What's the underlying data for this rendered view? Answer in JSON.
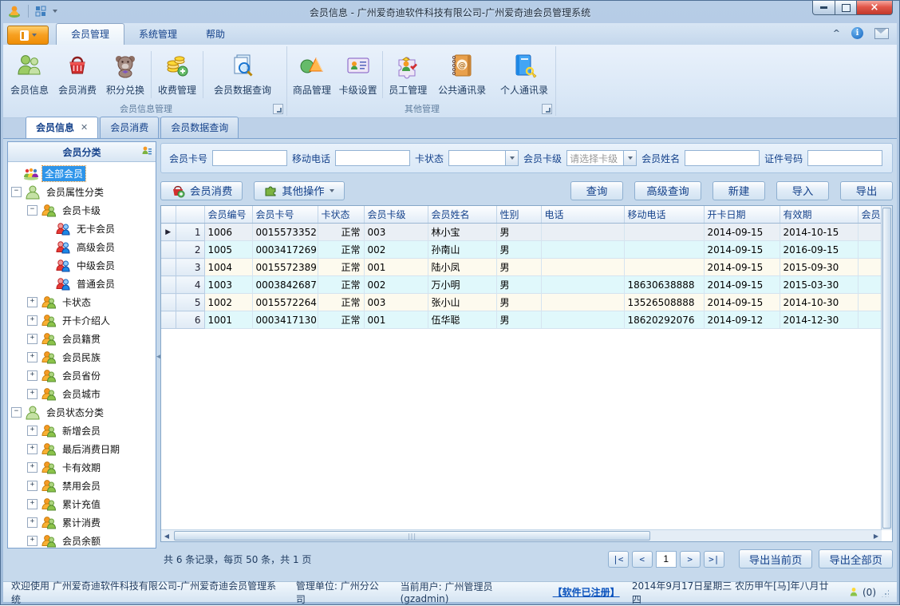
{
  "window": {
    "title": "会员信息 - 广州爱奇迪软件科技有限公司-广州爱奇迪会员管理系统",
    "controls": {
      "minimize": "最小化",
      "maximize": "最大化",
      "close": "×"
    }
  },
  "ribbon": {
    "tabs": [
      {
        "label": "会员管理",
        "active": true
      },
      {
        "label": "系统管理",
        "active": false
      },
      {
        "label": "帮助",
        "active": false
      }
    ],
    "groups": [
      {
        "label": "会员信息管理",
        "items": [
          {
            "label": "会员信息",
            "icon": "members-icon"
          },
          {
            "label": "会员消费",
            "icon": "basket-icon"
          },
          {
            "label": "积分兑换",
            "icon": "bear-icon"
          },
          {
            "label": "收费管理",
            "icon": "coins-icon",
            "sep_before": true
          },
          {
            "label": "会员数据查询",
            "icon": "doc-search-icon",
            "sep_before": true
          }
        ]
      },
      {
        "label": "其他管理",
        "items": [
          {
            "label": "商品管理",
            "icon": "goods-icon"
          },
          {
            "label": "卡级设置",
            "icon": "card-icon"
          },
          {
            "label": "员工管理",
            "icon": "staff-icon",
            "sep_before": true
          },
          {
            "label": "公共通讯录",
            "icon": "address-book-icon"
          },
          {
            "label": "个人通讯录",
            "icon": "personal-book-icon"
          }
        ]
      }
    ]
  },
  "doc_tabs": [
    {
      "label": "会员信息",
      "active": true,
      "closable": true
    },
    {
      "label": "会员消费",
      "active": false,
      "closable": false
    },
    {
      "label": "会员数据查询",
      "active": false,
      "closable": false
    }
  ],
  "sidebar": {
    "title": "会员分类",
    "tree": [
      {
        "label": "全部会员",
        "level": 1,
        "icon": "members-cluster-icon",
        "selected": true,
        "expand": ""
      },
      {
        "label": "会员属性分类",
        "level": 1,
        "icon": "member-group-icon",
        "expand": "minus"
      },
      {
        "label": "会员卡级",
        "level": 2,
        "icon": "member-pair-icon",
        "expand": "minus"
      },
      {
        "label": "无卡会员",
        "level": 3,
        "icon": "member-duo-icon",
        "expand": ""
      },
      {
        "label": "高级会员",
        "level": 3,
        "icon": "member-duo-icon",
        "expand": ""
      },
      {
        "label": "中级会员",
        "level": 3,
        "icon": "member-duo-icon",
        "expand": ""
      },
      {
        "label": "普通会员",
        "level": 3,
        "icon": "member-duo-icon",
        "expand": ""
      },
      {
        "label": "卡状态",
        "level": 2,
        "icon": "member-pair-icon",
        "expand": "plus"
      },
      {
        "label": "开卡介绍人",
        "level": 2,
        "icon": "member-pair-icon",
        "expand": "plus"
      },
      {
        "label": "会员籍贯",
        "level": 2,
        "icon": "member-pair-icon",
        "expand": "plus"
      },
      {
        "label": "会员民族",
        "level": 2,
        "icon": "member-pair-icon",
        "expand": "plus"
      },
      {
        "label": "会员省份",
        "level": 2,
        "icon": "member-pair-icon",
        "expand": "plus"
      },
      {
        "label": "会员城市",
        "level": 2,
        "icon": "member-pair-icon",
        "expand": "plus"
      },
      {
        "label": "会员状态分类",
        "level": 1,
        "icon": "member-group-icon",
        "expand": "minus"
      },
      {
        "label": "新增会员",
        "level": 2,
        "icon": "member-pair-icon",
        "expand": "plus"
      },
      {
        "label": "最后消费日期",
        "level": 2,
        "icon": "member-pair-icon",
        "expand": "plus"
      },
      {
        "label": "卡有效期",
        "level": 2,
        "icon": "member-pair-icon",
        "expand": "plus"
      },
      {
        "label": "禁用会员",
        "level": 2,
        "icon": "member-pair-icon",
        "expand": "plus"
      },
      {
        "label": "累计充值",
        "level": 2,
        "icon": "member-pair-icon",
        "expand": "plus"
      },
      {
        "label": "累计消费",
        "level": 2,
        "icon": "member-pair-icon",
        "expand": "plus"
      },
      {
        "label": "会员余额",
        "level": 2,
        "icon": "member-pair-icon",
        "expand": "plus"
      }
    ]
  },
  "filters": [
    {
      "label": "会员卡号",
      "type": "input",
      "value": ""
    },
    {
      "label": "移动电话",
      "type": "input",
      "value": ""
    },
    {
      "label": "卡状态",
      "type": "select",
      "value": ""
    },
    {
      "label": "会员卡级",
      "type": "select",
      "value": "请选择卡级"
    },
    {
      "label": "会员姓名",
      "type": "input",
      "value": ""
    },
    {
      "label": "证件号码",
      "type": "input",
      "value": ""
    }
  ],
  "toolbar": {
    "left": [
      {
        "label": "会员消费",
        "icon": "basket-plus-icon",
        "dropdown": false
      },
      {
        "label": "其他操作",
        "icon": "puzzle-icon",
        "dropdown": true
      }
    ],
    "right": [
      "查询",
      "高级查询",
      "新建",
      "导入",
      "导出"
    ]
  },
  "grid": {
    "columns": [
      "会员编号",
      "会员卡号",
      "卡状态",
      "会员卡级",
      "会员姓名",
      "性别",
      "电话",
      "移动电话",
      "开卡日期",
      "有效期",
      "会员"
    ],
    "rows": [
      {
        "num": "1",
        "current": true,
        "cells": [
          "1006",
          "0015573352",
          "正常",
          "003",
          "林小宝",
          "男",
          "",
          "",
          "2014-09-15",
          "2014-10-15",
          ""
        ]
      },
      {
        "num": "2",
        "current": false,
        "cells": [
          "1005",
          "0003417269",
          "正常",
          "002",
          "孙南山",
          "男",
          "",
          "",
          "2014-09-15",
          "2016-09-15",
          ""
        ]
      },
      {
        "num": "3",
        "current": false,
        "cells": [
          "1004",
          "0015572389",
          "正常",
          "001",
          "陆小凤",
          "男",
          "",
          "",
          "2014-09-15",
          "2015-09-30",
          ""
        ]
      },
      {
        "num": "4",
        "current": false,
        "cells": [
          "1003",
          "0003842687",
          "正常",
          "002",
          "万小明",
          "男",
          "",
          "18630638888",
          "2014-09-15",
          "2015-03-30",
          ""
        ]
      },
      {
        "num": "5",
        "current": false,
        "cells": [
          "1002",
          "0015572264",
          "正常",
          "003",
          "张小山",
          "男",
          "",
          "13526508888",
          "2014-09-15",
          "2014-10-30",
          ""
        ]
      },
      {
        "num": "6",
        "current": false,
        "cells": [
          "1001",
          "0003417130",
          "正常",
          "001",
          "伍华聪",
          "男",
          "",
          "18620292076",
          "2014-09-12",
          "2014-12-30",
          ""
        ]
      }
    ]
  },
  "pagination": {
    "summary": "共 6 条记录，每页 50 条，共 1 页",
    "first": "|<",
    "prev": "<",
    "page": "1",
    "next": ">",
    "last": ">|",
    "export_current": "导出当前页",
    "export_all": "导出全部页"
  },
  "statusbar": {
    "welcome": "欢迎使用 广州爱奇迪软件科技有限公司-广州爱奇迪会员管理系统",
    "unit": "管理单位: 广州分公司",
    "user": "当前用户: 广州管理员(gzadmin)",
    "registered": "【软件已注册】",
    "date": "2014年9月17日星期三 农历甲午[马]年八月廿四",
    "online_count": "(0)"
  }
}
